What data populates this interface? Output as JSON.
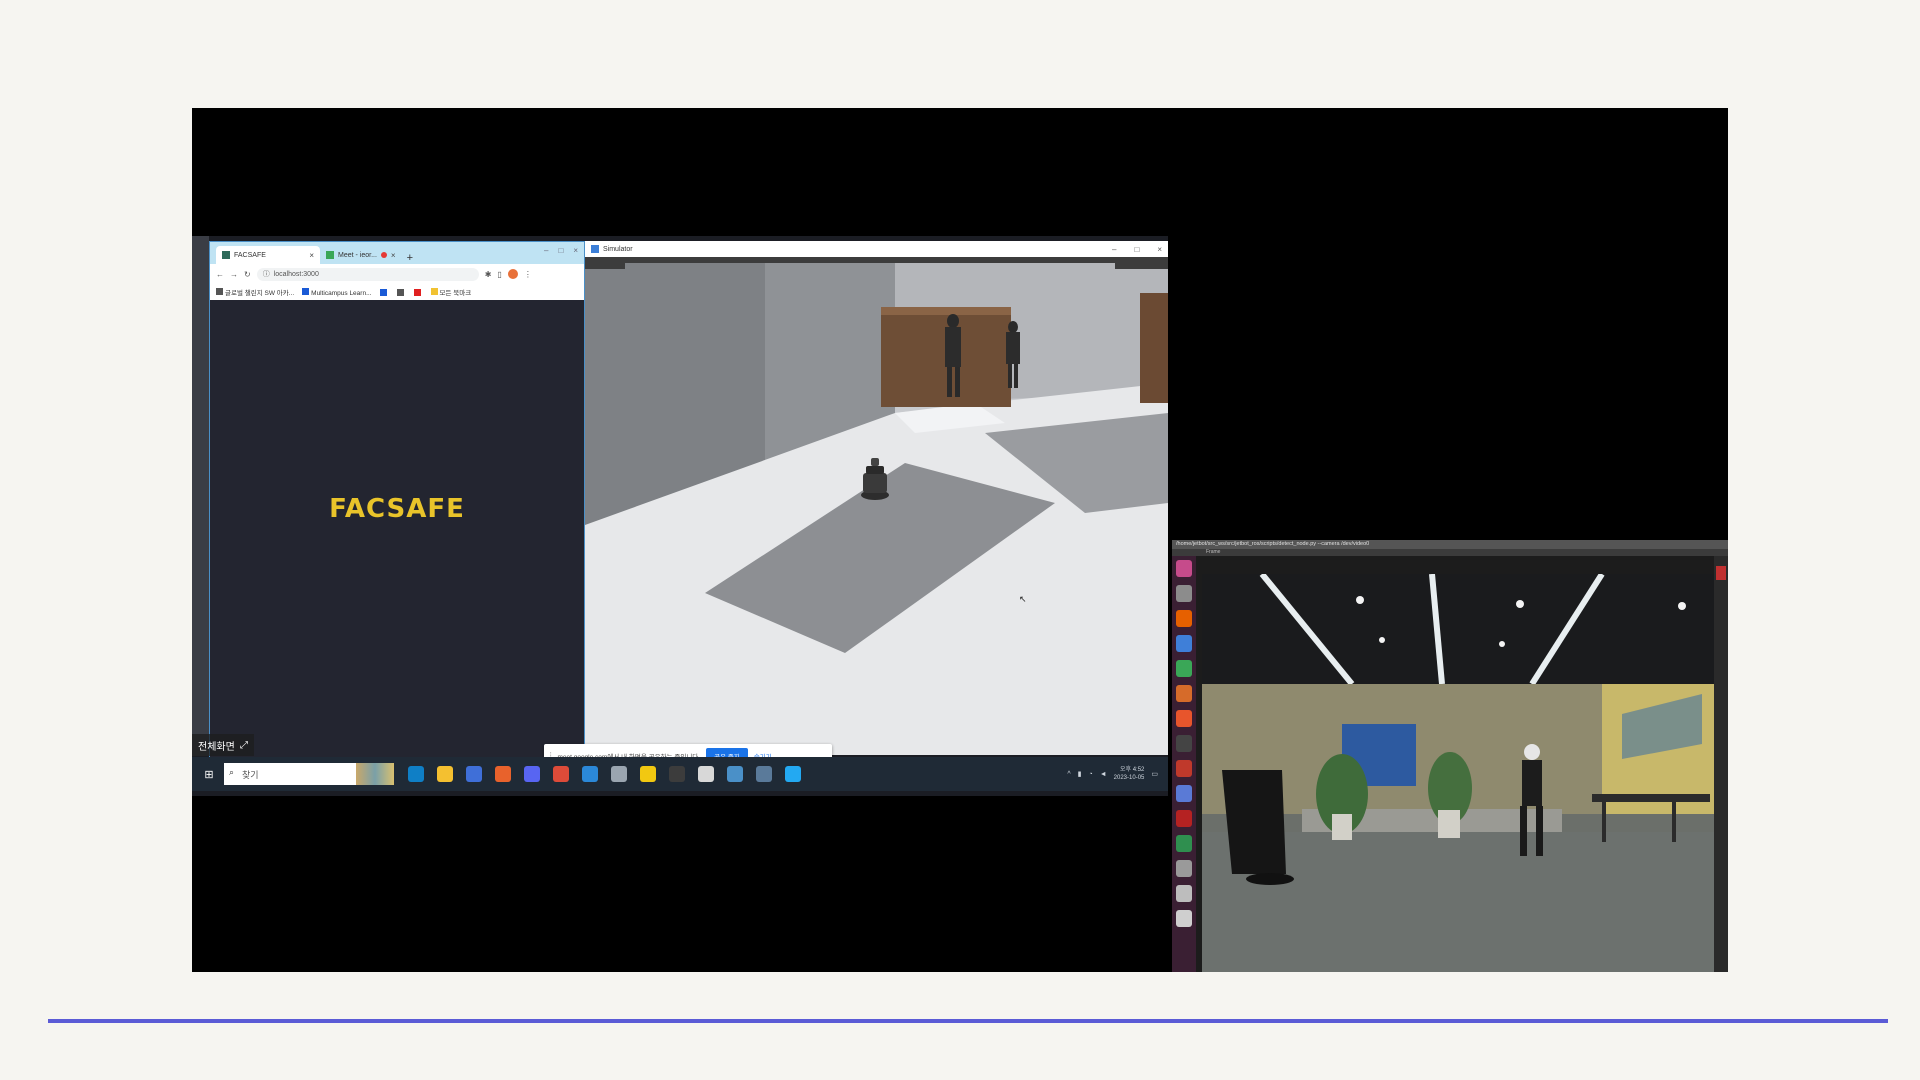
{
  "chrome": {
    "tab_active_label": "FACSAFE",
    "tab_active_close": "×",
    "tab_second_label": "Meet - ieor...",
    "tab_second_close": "×",
    "new_tab": "+",
    "window_controls": [
      "–",
      "□",
      "×"
    ],
    "address": "localhost:3000",
    "bookmarks": [
      "글로벌 챌린지 SW 아카...",
      "Multicampus Learn...",
      "모든 북마크"
    ],
    "page_title": "FACSAFE"
  },
  "simulator": {
    "title": "Simulator",
    "window_controls": [
      "–",
      "□",
      "×"
    ]
  },
  "screen_share": {
    "message": "meet.google.com에서 내 화면을 공유하는 중입니다.",
    "stop_label": "공유 중지",
    "hide_label": "숨기기"
  },
  "taskbar": {
    "start_icon": "⊞",
    "search_placeholder": "찾기",
    "time": "오후 4:52",
    "date": "2023-10-05",
    "overlay_label": "전체화면",
    "overlay_expand": "⤢"
  },
  "ubuntu": {
    "window_title": "/home/jetbot/src_ws/src/jetbot_ros/scripts/detect_node.py --camera /dev/video0",
    "subbar_label": "Frame"
  },
  "colors": {
    "brand_yellow": "#e9c42a",
    "accent_line": "#5b5bd6",
    "share_blue": "#1a73e8"
  }
}
